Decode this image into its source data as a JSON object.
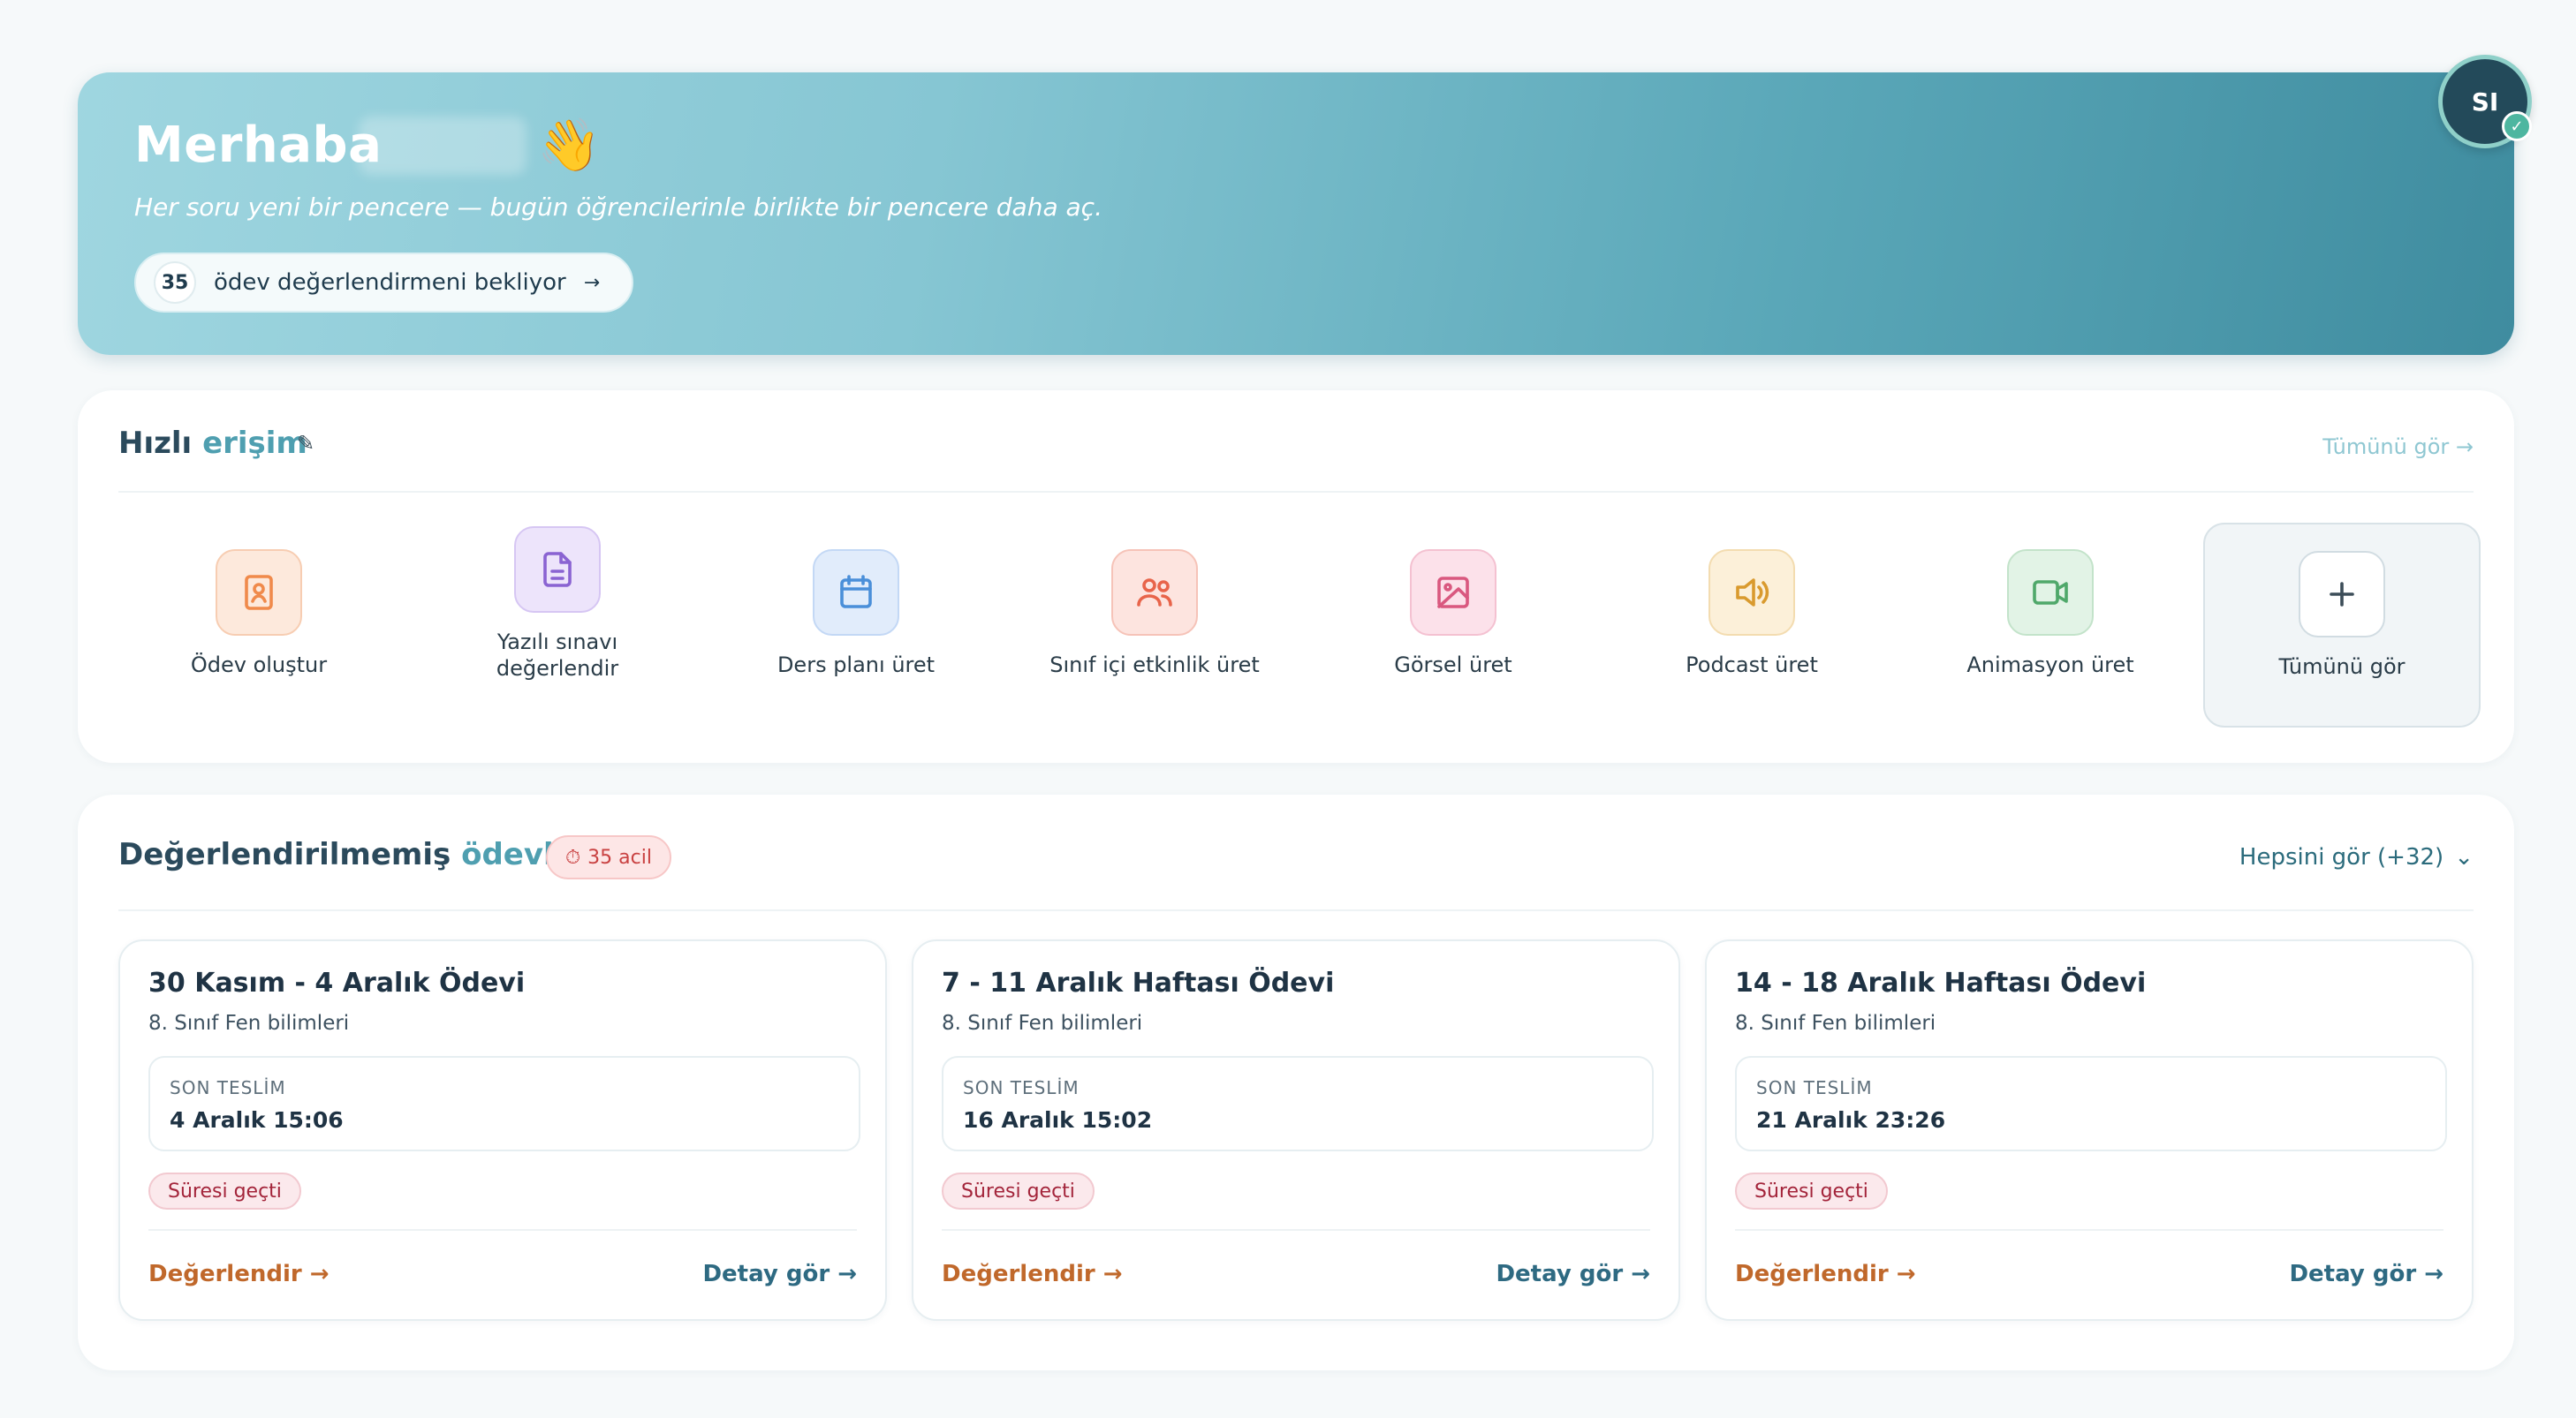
{
  "hero": {
    "greeting": "Merhaba",
    "wave_emoji": "👋",
    "subtitle": "Her soru yeni bir pencere — bugün öğrencilerinle birlikte bir pencere daha aç.",
    "pending_count": "35",
    "pending_label": "ödev değerlendirmeni bekliyor",
    "arrow": "→"
  },
  "avatar": {
    "initials": "SI",
    "badge_icon": "check-icon"
  },
  "quick_access": {
    "title_part1": "Hızlı",
    "title_part2": "erişim",
    "edit_icon": "pencil-icon",
    "see_all": "Tümünü gör →",
    "items": [
      {
        "label": "Ödev oluştur",
        "icon": "assignment-icon",
        "color": "#f08a4b"
      },
      {
        "label": "Yazılı sınavı değerlendir",
        "icon": "document-icon",
        "color": "#8a63d2"
      },
      {
        "label": "Ders planı üret",
        "icon": "calendar-icon",
        "color": "#4a8fd9"
      },
      {
        "label": "Sınıf içi etkinlik üret",
        "icon": "users-icon",
        "color": "#e8644a"
      },
      {
        "label": "Görsel üret",
        "icon": "image-icon",
        "color": "#d9587f"
      },
      {
        "label": "Podcast üret",
        "icon": "speaker-icon",
        "color": "#d99a2e"
      },
      {
        "label": "Animasyon üret",
        "icon": "video-icon",
        "color": "#4fa86a"
      }
    ],
    "all_label": "Tümünü gör",
    "all_icon": "plus-icon"
  },
  "unassessed": {
    "title_part1": "Değerlendirilmemiş",
    "title_part2": "ödevler",
    "urgent_icon": "clock-icon",
    "urgent_label": "35 acil",
    "see_all": "Hepsini gör (+32)",
    "cards": [
      {
        "title": "30 Kasım - 4 Aralık Ödevi",
        "subtitle": "8. Sınıf Fen bilimleri",
        "deadline_label": "SON TESLİM",
        "deadline_value": "4 Aralık 15:06",
        "status": "Süresi geçti",
        "action_left": "Değerlendir →",
        "action_right": "Detay gör →"
      },
      {
        "title": "7 - 11 Aralık Haftası Ödevi",
        "subtitle": "8. Sınıf Fen bilimleri",
        "deadline_label": "SON TESLİM",
        "deadline_value": "16 Aralık 15:02",
        "status": "Süresi geçti",
        "action_left": "Değerlendir →",
        "action_right": "Detay gör →"
      },
      {
        "title": "14 - 18 Aralık Haftası Ödevi",
        "subtitle": "8. Sınıf Fen bilimleri",
        "deadline_label": "SON TESLİM",
        "deadline_value": "21 Aralık 23:26",
        "status": "Süresi geçti",
        "action_left": "Değerlendir →",
        "action_right": "Detay gör →"
      }
    ]
  }
}
